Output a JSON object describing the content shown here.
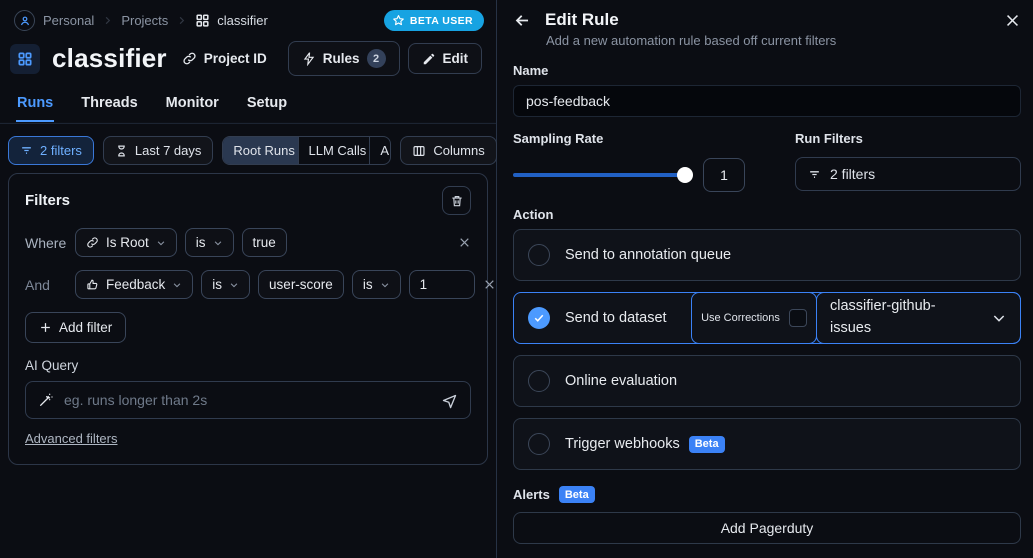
{
  "breadcrumb": {
    "items": [
      "Personal",
      "Projects",
      "classifier"
    ]
  },
  "beta_user_badge": "BETA USER",
  "project": {
    "title": "classifier",
    "project_id_button": "Project ID",
    "rules_button": "Rules",
    "rules_count": "2",
    "edit_button": "Edit"
  },
  "tabs": [
    {
      "label": "Runs",
      "active": true
    },
    {
      "label": "Threads",
      "active": false
    },
    {
      "label": "Monitor",
      "active": false
    },
    {
      "label": "Setup",
      "active": false
    }
  ],
  "toolbar": {
    "filters_button": "2 filters",
    "date_range_button": "Last 7 days",
    "run_type_options": [
      "Root Runs",
      "LLM Calls",
      "All Runs"
    ],
    "columns_button": "Columns"
  },
  "filters_panel": {
    "title": "Filters",
    "row1": {
      "conjunction": "Where",
      "field": "Is Root",
      "operator": "is",
      "value": "true"
    },
    "row2": {
      "conjunction": "And",
      "field": "Feedback",
      "operator": "is",
      "key": "user-score",
      "operator2": "is",
      "value": "1"
    },
    "add_filter_button": "Add filter",
    "ai_query": {
      "label": "AI Query",
      "placeholder": "eg. runs longer than 2s"
    },
    "advanced_filters_link": "Advanced filters"
  },
  "edit_rule": {
    "title": "Edit Rule",
    "subtitle": "Add a new automation rule based off current filters",
    "name_label": "Name",
    "name_value": "pos-feedback",
    "sampling_rate_label": "Sampling Rate",
    "sampling_rate_value": "1",
    "run_filters_label": "Run Filters",
    "run_filters_value": "2 filters",
    "action_label": "Action",
    "options": [
      {
        "label": "Send to annotation queue",
        "selected": false
      },
      {
        "label": "Send to dataset",
        "selected": true,
        "use_corrections_label": "Use Corrections",
        "dataset_value": "classifier-github-issues"
      },
      {
        "label": "Online evaluation",
        "selected": false
      },
      {
        "label": "Trigger webhooks",
        "selected": false,
        "badge": "Beta"
      }
    ],
    "alerts_label": "Alerts",
    "alerts_badge": "Beta",
    "add_pagerduty_button": "Add Pagerduty"
  },
  "colors": {
    "accent_blue": "#4c9aff",
    "selected_border": "#3b82f6",
    "beta_user_bg": "#17a3e2",
    "beta_badge_bg": "#3b82f6",
    "background": "#0b0d13"
  }
}
